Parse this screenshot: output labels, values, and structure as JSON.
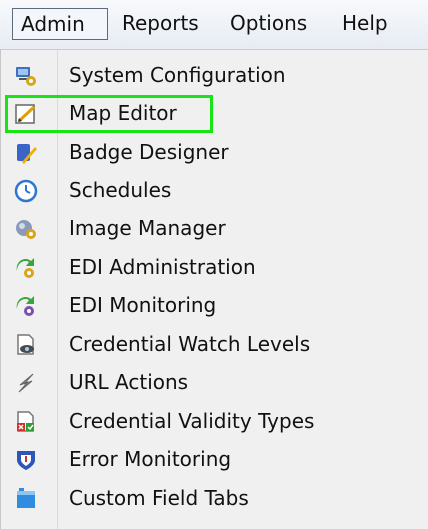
{
  "menubar": {
    "items": [
      {
        "label": "Admin",
        "active": true
      },
      {
        "label": "Reports",
        "active": false
      },
      {
        "label": "Options",
        "active": false
      },
      {
        "label": "Help",
        "active": false
      }
    ]
  },
  "admin_menu": {
    "items": [
      {
        "label": "System Configuration",
        "icon": "system-configuration-icon"
      },
      {
        "label": "Map Editor",
        "icon": "map-editor-icon",
        "highlighted": true
      },
      {
        "label": "Badge Designer",
        "icon": "badge-designer-icon"
      },
      {
        "label": "Schedules",
        "icon": "schedules-clock-icon"
      },
      {
        "label": "Image Manager",
        "icon": "image-manager-icon"
      },
      {
        "label": "EDI Administration",
        "icon": "edi-administration-icon"
      },
      {
        "label": "EDI Monitoring",
        "icon": "edi-monitoring-icon"
      },
      {
        "label": "Credential Watch Levels",
        "icon": "credential-watch-levels-icon"
      },
      {
        "label": "URL Actions",
        "icon": "url-actions-icon"
      },
      {
        "label": "Credential Validity Types",
        "icon": "credential-validity-types-icon"
      },
      {
        "label": "Error Monitoring",
        "icon": "error-monitoring-icon"
      },
      {
        "label": "Custom Field Tabs",
        "icon": "custom-field-tabs-icon"
      }
    ]
  },
  "colors": {
    "highlight": "#17e317",
    "menu_background": "#f0f0f0"
  }
}
